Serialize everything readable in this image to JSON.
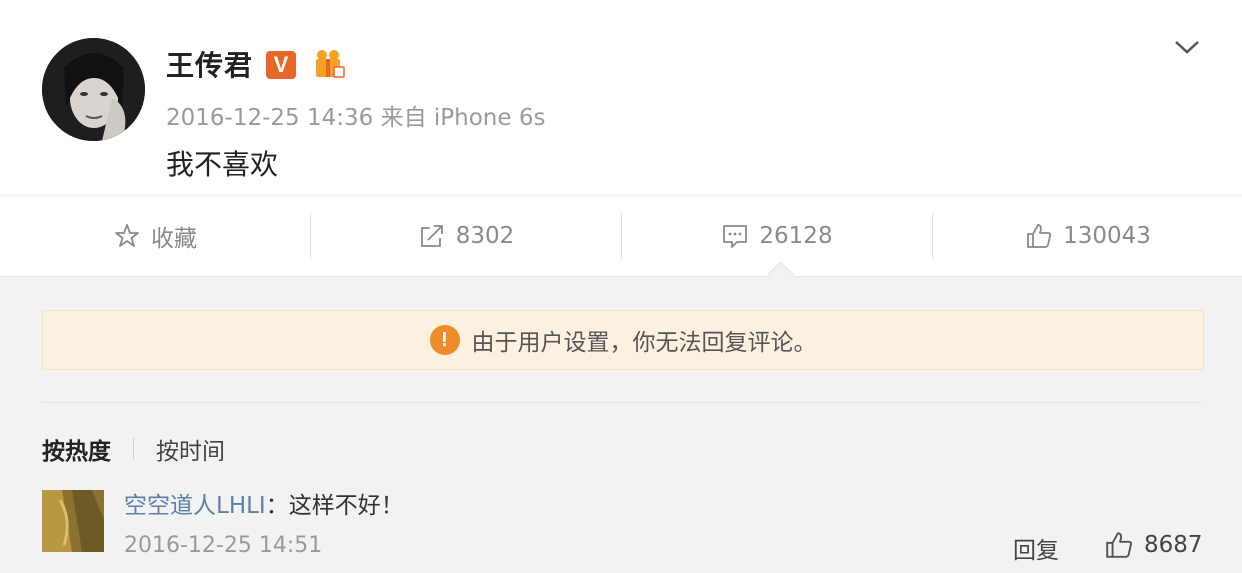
{
  "post": {
    "username": "王传君",
    "verified_badge": "V",
    "timestamp": "2016-12-25 14:36",
    "source": "来自 iPhone 6s",
    "content": "我不喜欢",
    "icons": {
      "avatar": "avatar",
      "verified": "verified-v-icon",
      "vip": "vip-gift-icon",
      "menu": "chevron-down-icon"
    }
  },
  "actions": {
    "favorite_label": "收藏",
    "repost_count": "8302",
    "comment_count": "26128",
    "like_count": "130043"
  },
  "notice": {
    "icon_glyph": "!",
    "text": "由于用户设置，你无法回复评论。"
  },
  "sort": {
    "hot_label": "按热度",
    "time_label": "按时间"
  },
  "comments": [
    {
      "name": "空空道人LHLI",
      "separator": "：",
      "text": "这样不好！",
      "timestamp": "2016-12-25 14:51",
      "reply_label": "回复",
      "likes": "8687"
    }
  ],
  "colors": {
    "accent_orange": "#e8662a",
    "notice_bg": "#fcf0e0",
    "link_blue": "#5d7fa8"
  }
}
